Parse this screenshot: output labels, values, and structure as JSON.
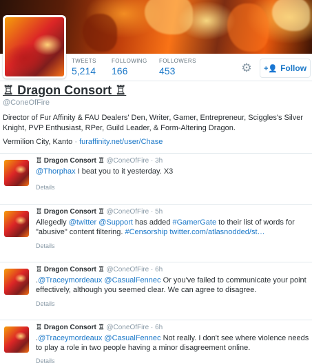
{
  "profile": {
    "name": "♖ Dragon Consort ♖",
    "handle": "@ConeOfFire",
    "bio": "Director of Fur Affinity & FAU Dealers' Den, Writer, Gamer, Entrepreneur, Sciggles's Silver Knight, PVP Enthusiast, RPer, Guild Leader, & Form-Altering Dragon.",
    "location": "Vermilion City, Kanto",
    "separator": "·",
    "url": "furaffinity.net/user/Chase"
  },
  "stats": {
    "tweets_label": "TWEETS",
    "tweets_value": "5,214",
    "following_label": "FOLLOWING",
    "following_value": "166",
    "followers_label": "FOLLOWERS",
    "followers_value": "453"
  },
  "actions": {
    "gear_icon": "gear-icon",
    "follow_label": "Follow",
    "follow_icon": "+👤"
  },
  "tweets": [
    {
      "name": "♖ Dragon Consort ♖",
      "handle": "@ConeOfFire",
      "sep": " · ",
      "time": "3h",
      "parts": [
        {
          "text": "@Thorphax",
          "link": true
        },
        {
          "text": " I beat you to it yesterday. X3",
          "link": false
        }
      ],
      "details": "Details"
    },
    {
      "name": "♖ Dragon Consort ♖",
      "handle": "@ConeOfFire",
      "sep": " · ",
      "time": "5h",
      "parts": [
        {
          "text": "Allegedly ",
          "link": false
        },
        {
          "text": "@twitter",
          "link": true
        },
        {
          "text": " ",
          "link": false
        },
        {
          "text": "@Support",
          "link": true
        },
        {
          "text": " has added ",
          "link": false
        },
        {
          "text": "#GamerGate",
          "link": true
        },
        {
          "text": " to their list of words for \"abusive\" content filtering. ",
          "link": false
        },
        {
          "text": "#Censorship",
          "link": true
        },
        {
          "text": " ",
          "link": false
        },
        {
          "text": "twitter.com/atlasnodded/st…",
          "link": true
        }
      ],
      "details": "Details"
    },
    {
      "name": "♖ Dragon Consort ♖",
      "handle": "@ConeOfFire",
      "sep": " · ",
      "time": "6h",
      "parts": [
        {
          "text": ".",
          "link": false
        },
        {
          "text": "@Traceymordeaux",
          "link": true
        },
        {
          "text": " ",
          "link": false
        },
        {
          "text": "@CasualFennec",
          "link": true
        },
        {
          "text": " Or you've failed to communicate your point effectively, although you seemed clear. We can agree to disagree.",
          "link": false
        }
      ],
      "details": "Details"
    },
    {
      "name": "♖ Dragon Consort ♖",
      "handle": "@ConeOfFire",
      "sep": " · ",
      "time": "6h",
      "parts": [
        {
          "text": ".",
          "link": false
        },
        {
          "text": "@Traceymordeaux",
          "link": true
        },
        {
          "text": " ",
          "link": false
        },
        {
          "text": "@CasualFennec",
          "link": true
        },
        {
          "text": " Not really. I don't see where violence needs to play a role in two people having a minor disagreement online.",
          "link": false
        }
      ],
      "details": "Details"
    }
  ],
  "colors": {
    "link": "#1b78c8",
    "muted": "#8899a6",
    "text": "#292f33",
    "border": "#e1e8ed"
  }
}
